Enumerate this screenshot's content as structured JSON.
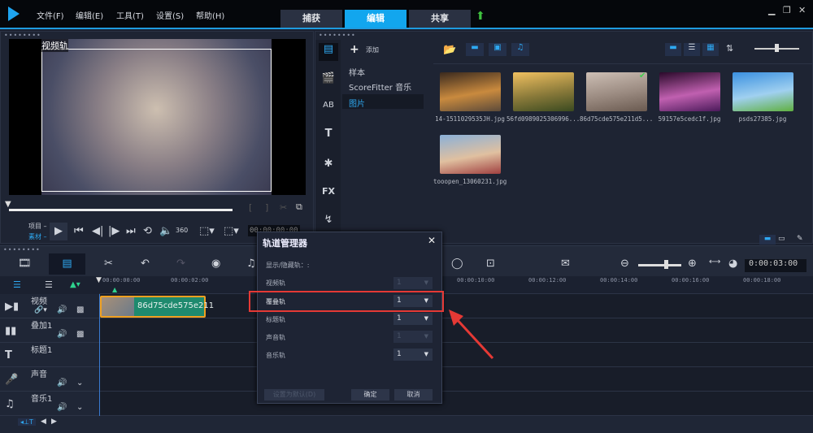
{
  "menu": [
    "文件(F)",
    "编辑(E)",
    "工具(T)",
    "设置(S)",
    "帮助(H)"
  ],
  "tabs": [
    "捕获",
    "编辑",
    "共享"
  ],
  "preview": {
    "overlay_label": "视频轨",
    "mode_project": "项目 –",
    "mode_clip": "素材 –",
    "timecode": "00:00:00:00"
  },
  "library": {
    "add_label": "添加",
    "categories": [
      "样本",
      "ScoreFitter 音乐",
      "图片"
    ],
    "thumbnails": [
      {
        "name": "14-1511029535JH.jpg",
        "colors": [
          "#3a2a1e",
          "#c98a3e",
          "#5b4a3a"
        ]
      },
      {
        "name": "56fd0989025306996...",
        "colors": [
          "#f0c060",
          "#8a7a3a",
          "#3a4a20"
        ]
      },
      {
        "name": "86d75cde575e211d5...",
        "colors": [
          "#cdbfb5",
          "#9a8a80",
          "#6a5a50"
        ],
        "checked": true
      },
      {
        "name": "59157e5cedc1f.jpg",
        "colors": [
          "#2a0a2a",
          "#c060b0",
          "#4a1a5a"
        ]
      },
      {
        "name": "psds27385.jpg",
        "colors": [
          "#3a90e0",
          "#a0d0f0",
          "#60b040"
        ]
      },
      {
        "name": "tooopen_13060231.jpg",
        "colors": [
          "#8ab0d8",
          "#e0c0a0",
          "#a04040"
        ]
      }
    ]
  },
  "timeline": {
    "timecode": "0:00:03:00",
    "ruler": [
      "00:00:00:00",
      "00:00:02:00",
      "00:00:10:00",
      "00:00:12:00",
      "00:00:14:00",
      "00:00:16:00",
      "00:00:18:00"
    ],
    "tracks": [
      "视频",
      "叠加1",
      "标题1",
      "声音",
      "音乐1"
    ],
    "clip_name": "86d75cde575e211"
  },
  "dialog": {
    "title": "轨道管理器",
    "subtitle": "显示/隐藏轨：:",
    "rows": [
      {
        "label": "视频轨",
        "value": "1",
        "disabled": true
      },
      {
        "label": "覆叠轨",
        "value": "1"
      },
      {
        "label": "标题轨",
        "value": "1"
      },
      {
        "label": "声音轨",
        "value": "1",
        "disabled": true
      },
      {
        "label": "音乐轨",
        "value": "1"
      }
    ],
    "default_btn": "设置为默认(D)",
    "ok": "确定",
    "cancel": "取消"
  },
  "colors": {
    "accent": "#12a6ee",
    "highlight": "#e53935",
    "clip": "#1e8a6e"
  }
}
